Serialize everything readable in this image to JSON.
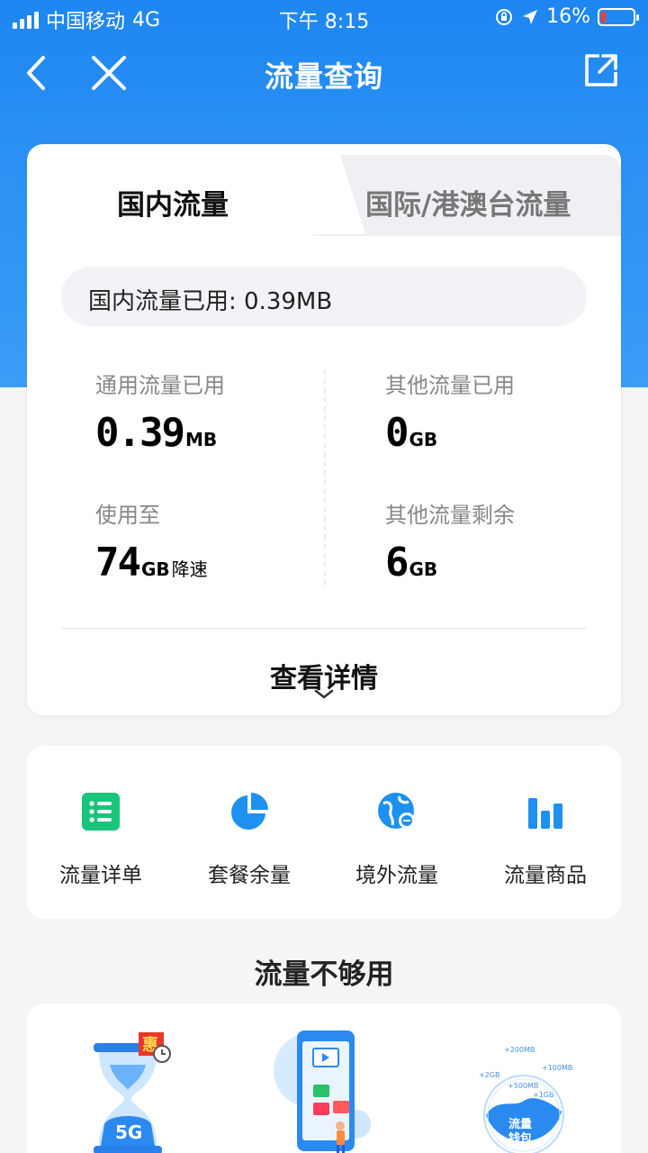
{
  "status_bar": {
    "carrier": "中国移动",
    "network": "4G",
    "time": "下午 8:15",
    "battery": "16%",
    "battery_level": 0.16
  },
  "nav": {
    "title": "流量查询",
    "back_icon": "chevron-left-icon",
    "close_icon": "close-icon",
    "share_icon": "share-icon"
  },
  "tabs": [
    {
      "label": "国内流量",
      "active": true
    },
    {
      "label": "国际/港澳台流量",
      "active": false
    }
  ],
  "usage": {
    "summary_label": "国内流量已用: 0.39MB",
    "stats": [
      {
        "label": "通用流量已用",
        "value": "0.39",
        "unit": "MB",
        "suffix": ""
      },
      {
        "label": "其他流量已用",
        "value": "0",
        "unit": "GB",
        "suffix": ""
      },
      {
        "label": "使用至",
        "value": "74",
        "unit": "GB",
        "suffix": "降速"
      },
      {
        "label": "其他流量剩余",
        "value": "6",
        "unit": "GB",
        "suffix": ""
      }
    ],
    "details_label": "查看详情"
  },
  "quick_actions": [
    {
      "label": "流量详单",
      "icon": "list-icon",
      "color": "#19c57a"
    },
    {
      "label": "套餐余量",
      "icon": "pie-chart-icon",
      "color": "#1e90f0"
    },
    {
      "label": "境外流量",
      "icon": "globe-icon",
      "color": "#1e90f0"
    },
    {
      "label": "流量商品",
      "icon": "bar-chart-icon",
      "color": "#1e90f0"
    }
  ],
  "promo": {
    "title": "流量不够用",
    "items": [
      {
        "icon": "hourglass-5g-icon",
        "badge": "惠"
      },
      {
        "icon": "phone-apps-icon"
      },
      {
        "icon": "data-wallet-icon",
        "labels": [
          "+200MB",
          "+100MB",
          "+2GB",
          "+500MB",
          "+1GB"
        ],
        "wallet_label": "流量钱包"
      }
    ]
  },
  "colors": {
    "brand_blue": "#1e86f2",
    "accent_green": "#19c57a",
    "low_battery": "#ff3b30"
  }
}
